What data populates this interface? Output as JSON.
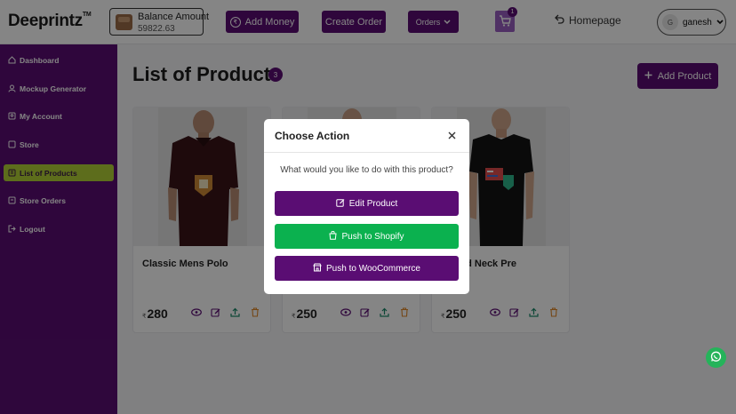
{
  "header": {
    "logo": "Deeprintz",
    "logo_tm": "TM",
    "balance_label": "Balance Amount",
    "balance_value": "59822.63",
    "add_money": "Add Money",
    "create_order": "Create Order",
    "orders": "Orders",
    "cart_count": "1",
    "homepage": "Homepage",
    "user_initial": "G",
    "user_name": "ganesh"
  },
  "sidebar": {
    "items": [
      {
        "label": "Dashboard",
        "icon": "home-icon"
      },
      {
        "label": "Mockup Generator",
        "icon": "user-icon"
      },
      {
        "label": "My Account",
        "icon": "account-icon"
      },
      {
        "label": "Store",
        "icon": "store-icon"
      },
      {
        "label": "List of Products",
        "icon": "list-icon",
        "active": true
      },
      {
        "label": "Store Orders",
        "icon": "orders-icon"
      },
      {
        "label": "Logout",
        "icon": "logout-icon"
      }
    ]
  },
  "main": {
    "title": "List of Products",
    "count": "3",
    "add_product": "Add Product",
    "currency": "₹",
    "products": [
      {
        "name": "Classic Mens Polo",
        "price": "280"
      },
      {
        "name": "",
        "price": "250"
      },
      {
        "name": "Round Neck Pre",
        "price": "250"
      }
    ]
  },
  "modal": {
    "title": "Choose Action",
    "question": "What would you like to do with this product?",
    "edit": "Edit Product",
    "shopify": "Push to Shopify",
    "woo": "Push to WooCommerce"
  },
  "colors": {
    "brand": "#5a0d73",
    "active_nav": "#b3d236",
    "shopify": "#0bb14f",
    "whatsapp": "#25b35a"
  }
}
